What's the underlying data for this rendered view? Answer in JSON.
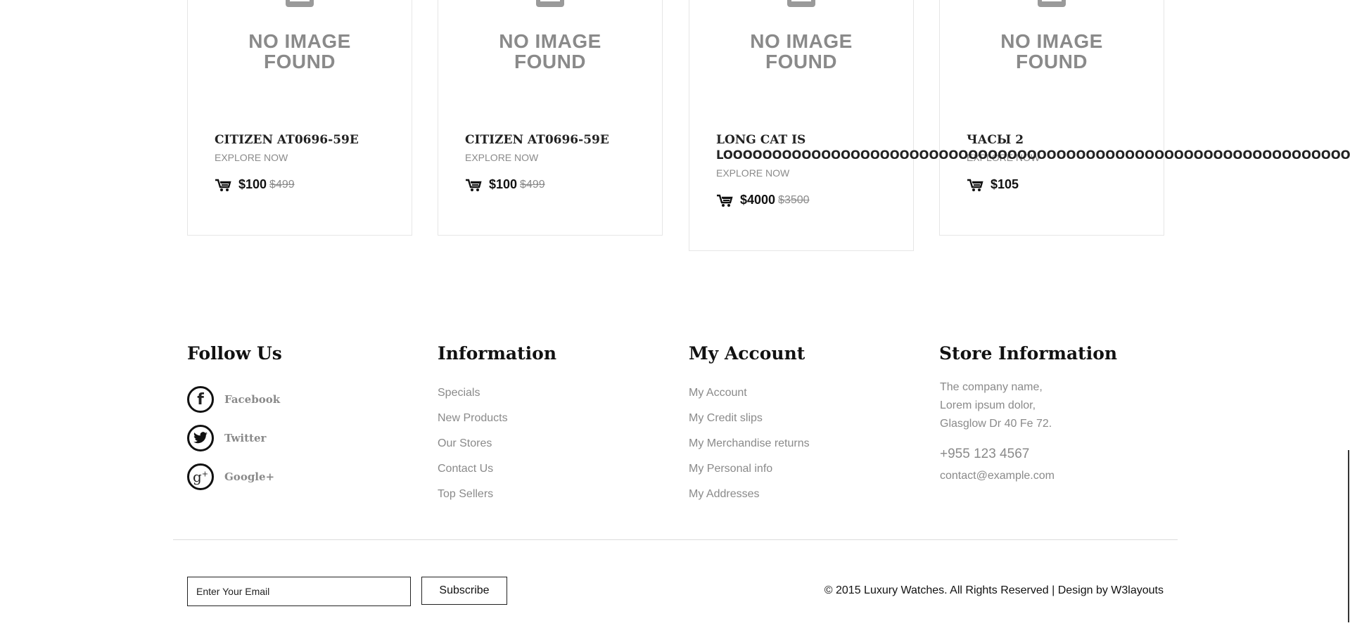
{
  "products": [
    {
      "image_text_1": "NO IMAGE",
      "image_text_2": "FOUND",
      "title": "CITIZEN AT0696-59E",
      "explore": "EXPLORE NOW",
      "price": "$100",
      "old_price": "$499"
    },
    {
      "image_text_1": "NO IMAGE",
      "image_text_2": "FOUND",
      "title": "CITIZEN AT0696-59E",
      "explore": "EXPLORE NOW",
      "price": "$100",
      "old_price": "$499"
    },
    {
      "image_text_1": "NO IMAGE",
      "image_text_2": "FOUND",
      "title_line1": "LONG CAT IS",
      "title_line2": "LOOOOOOOOOOOOOOOOOOOOOOOOOOOOOOOOOOOOOOOOOOOOOOOOOOOOOOOOOOOOOOOOOOONG",
      "explore": "EXPLORE NOW",
      "price": "$4000",
      "old_price": "$3500"
    },
    {
      "image_text_1": "NO IMAGE",
      "image_text_2": "FOUND",
      "title": "ЧАСЫ 2",
      "explore": "EXPLORE NOW",
      "price": "$105"
    }
  ],
  "footer": {
    "follow": {
      "heading": "Follow Us",
      "items": [
        {
          "label": "Facebook",
          "icon": "facebook-icon"
        },
        {
          "label": "Twitter",
          "icon": "twitter-icon"
        },
        {
          "label": "Google+",
          "icon": "google-plus-icon"
        }
      ]
    },
    "information": {
      "heading": "Information",
      "links": [
        "Specials",
        "New Products",
        "Our Stores",
        "Contact Us",
        "Top Sellers"
      ]
    },
    "account": {
      "heading": "My Account",
      "links": [
        "My Account",
        "My Credit slips",
        "My Merchandise returns",
        "My Personal info",
        "My Addresses"
      ]
    },
    "store": {
      "heading": "Store Information",
      "lines": [
        "The company name,",
        "Lorem ipsum dolor,",
        "Glasglow Dr 40 Fe 72."
      ],
      "phone": "+955 123 4567",
      "email": "contact@example.com"
    },
    "subscribe": {
      "placeholder": "Enter Your Email",
      "button": "Subscribe"
    },
    "copyright": "© 2015 Luxury Watches. All Rights Reserved | Design by W3layouts"
  },
  "colors": {
    "text": "#222222",
    "muted": "#8a8a8a",
    "border": "#e6e6e6"
  }
}
